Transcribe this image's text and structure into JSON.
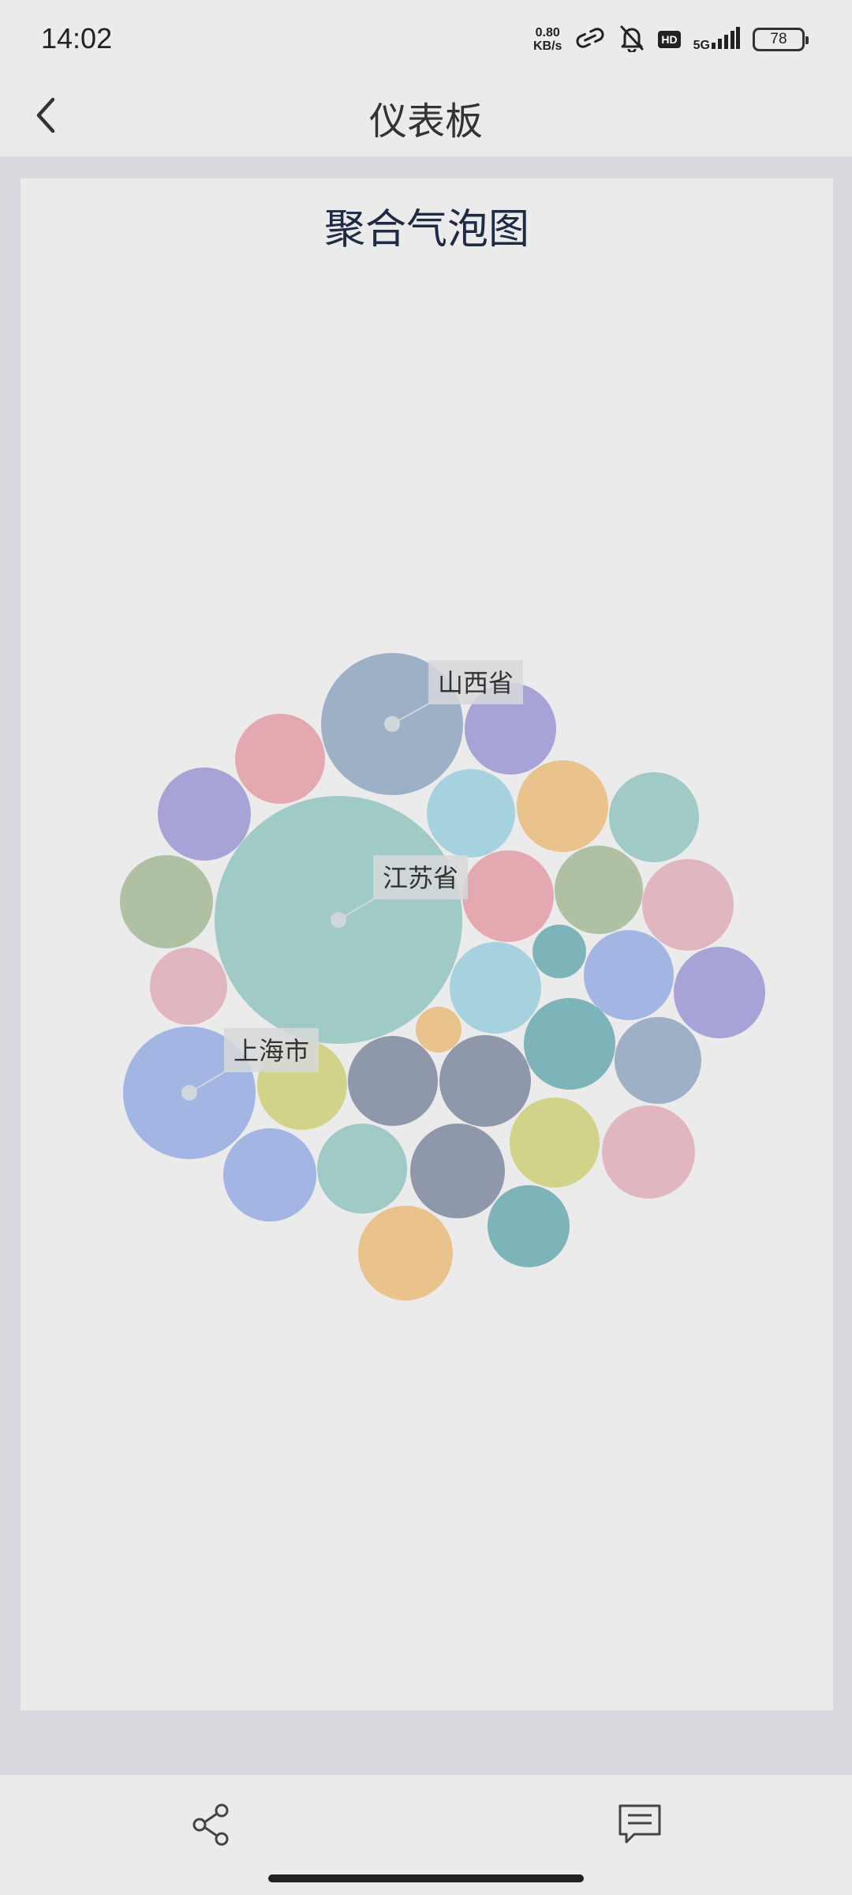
{
  "status_bar": {
    "time": "14:02",
    "net_speed_value": "0.80",
    "net_speed_unit": "KB/s",
    "hd_label": "HD",
    "network_label": "5G",
    "battery_level": "78",
    "icons": [
      "link-icon",
      "bell-off-icon",
      "signal-icon"
    ]
  },
  "nav": {
    "back_icon": "chevron-left-icon",
    "title": "仪表板"
  },
  "chart_data": {
    "type": "packed-bubble",
    "title": "聚合气泡图",
    "labeled_bubbles": [
      "山西省",
      "江苏省",
      "上海市"
    ],
    "palette": [
      "#9fcac6",
      "#9eb0c6",
      "#a3b5e3",
      "#a8a3d6",
      "#e3a8b0",
      "#e0b6c0",
      "#a6d2df",
      "#eac28c",
      "#afc1a2",
      "#7db4ba",
      "#d1d488",
      "#8f98ab"
    ]
  },
  "bottom_bar": {
    "share_icon": "share-icon",
    "comment_icon": "comment-icon"
  }
}
